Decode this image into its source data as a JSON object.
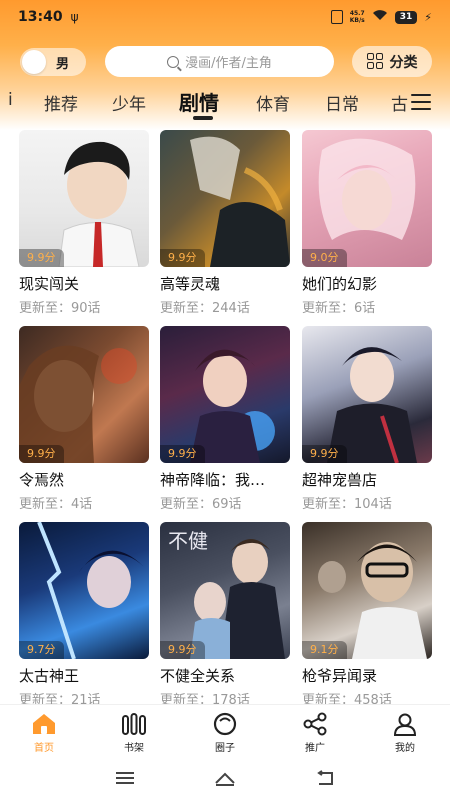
{
  "status_bar": {
    "time": "13:40",
    "usb_icon": "usb-icon",
    "speed_value": "45.7",
    "speed_unit": "KB/s",
    "battery": "31"
  },
  "header": {
    "gender_label": "男",
    "search_placeholder": "漫画/作者/主角",
    "category_label": "分类"
  },
  "tabs": [
    {
      "label": "i"
    },
    {
      "label": "推荐"
    },
    {
      "label": "少年"
    },
    {
      "label": "剧情"
    },
    {
      "label": "体育"
    },
    {
      "label": "日常"
    },
    {
      "label": "古"
    }
  ],
  "active_tab": "剧情",
  "comics": [
    {
      "title": "现实闯关",
      "rating": "9.9分",
      "update": "更新至：90话"
    },
    {
      "title": "高等灵魂",
      "rating": "9.9分",
      "update": "更新至：244话"
    },
    {
      "title": "她们的幻影",
      "rating": "9.0分",
      "update": "更新至：6话"
    },
    {
      "title": "令焉然",
      "rating": "9.9分",
      "update": "更新至：4话"
    },
    {
      "title": "神帝降临：我…",
      "rating": "9.9分",
      "update": "更新至：69话"
    },
    {
      "title": "超神宠兽店",
      "rating": "9.9分",
      "update": "更新至：104话"
    },
    {
      "title": "太古神王",
      "rating": "9.7分",
      "update": "更新至：21话"
    },
    {
      "title": "不健全关系",
      "rating": "9.9分",
      "update": "更新至：178话"
    },
    {
      "title": "枪爷异闻录",
      "rating": "9.1分",
      "update": "更新至：458话"
    }
  ],
  "bottom_nav": [
    {
      "label": "首页",
      "icon": "home-icon"
    },
    {
      "label": "书架",
      "icon": "bookshelf-icon"
    },
    {
      "label": "圈子",
      "icon": "circle-icon"
    },
    {
      "label": "推广",
      "icon": "share-icon"
    },
    {
      "label": "我的",
      "icon": "profile-icon"
    }
  ],
  "colors": {
    "accent": "#ff9a2e",
    "rating_text": "#ffb04a"
  }
}
